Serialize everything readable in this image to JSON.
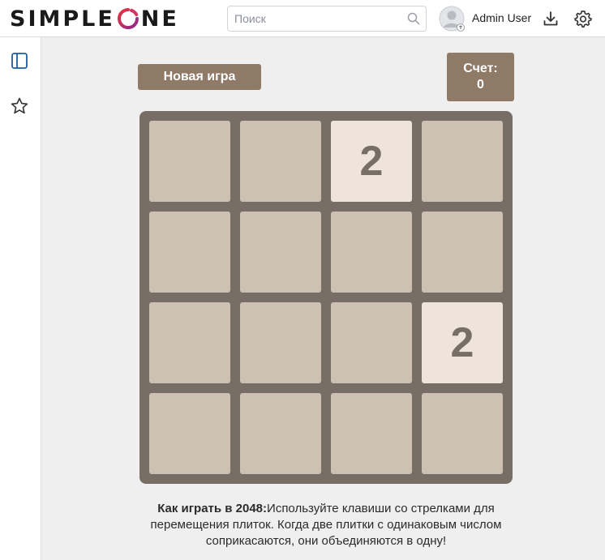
{
  "header": {
    "logo_text_left": "SIMPLE",
    "logo_text_right": "NE",
    "search_placeholder": "Поиск",
    "user_name": "Admin User"
  },
  "icons": {
    "search": "search-icon",
    "avatar": "avatar-icon",
    "download": "download-icon",
    "settings": "gear-icon",
    "sidebar_toggle": "sidebar-toggle-icon",
    "favorites": "star-icon"
  },
  "colors": {
    "accent_blue": "#1f5c9e",
    "button_brown": "#8f7a67",
    "board": "#776e65",
    "empty_cell": "#cdc1b4",
    "tile_2": "#eee4da"
  },
  "game": {
    "new_game_label": "Новая игра",
    "score_label": "Счет:",
    "score_value": "0",
    "grid": [
      [
        "",
        "",
        "2",
        ""
      ],
      [
        "",
        "",
        "",
        ""
      ],
      [
        "",
        "",
        "",
        "2"
      ],
      [
        "",
        "",
        "",
        ""
      ]
    ],
    "instructions_bold": "Как играть в 2048:",
    "instructions_text": "Используйте клавиши со стрелками для перемещения плиток. Когда две плитки с одинаковым числом соприкасаются, они объединяются в одну!"
  }
}
